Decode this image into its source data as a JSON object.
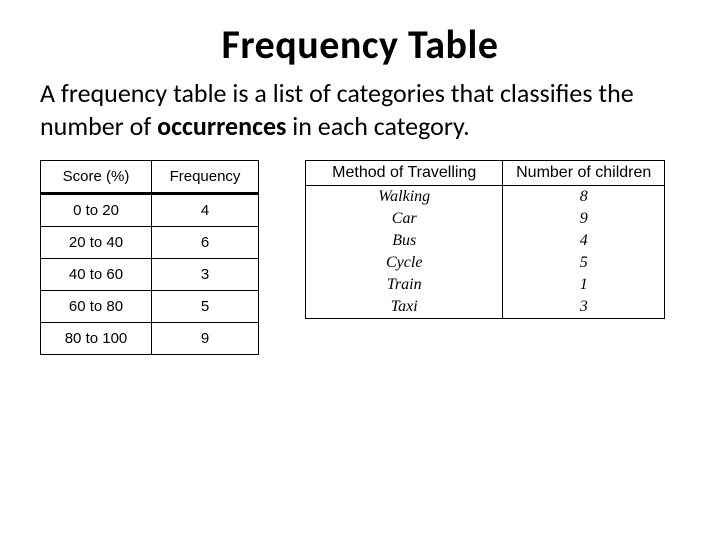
{
  "title": "Frequency Table",
  "desc_pre": "A frequency table is a list of categories that classifies the number of ",
  "desc_bold": "occurrences",
  "desc_post": " in each category.",
  "table1": {
    "headers": [
      "Score (%)",
      "Frequency"
    ],
    "rows": [
      [
        "0 to 20",
        "4"
      ],
      [
        "20 to 40",
        "6"
      ],
      [
        "40 to 60",
        "3"
      ],
      [
        "60 to 80",
        "5"
      ],
      [
        "80 to 100",
        "9"
      ]
    ]
  },
  "table2": {
    "headers": [
      "Method of Travelling",
      "Number of children"
    ],
    "rows": [
      [
        "Walking",
        "8"
      ],
      [
        "Car",
        "9"
      ],
      [
        "Bus",
        "4"
      ],
      [
        "Cycle",
        "5"
      ],
      [
        "Train",
        "1"
      ],
      [
        "Taxi",
        "3"
      ]
    ]
  }
}
